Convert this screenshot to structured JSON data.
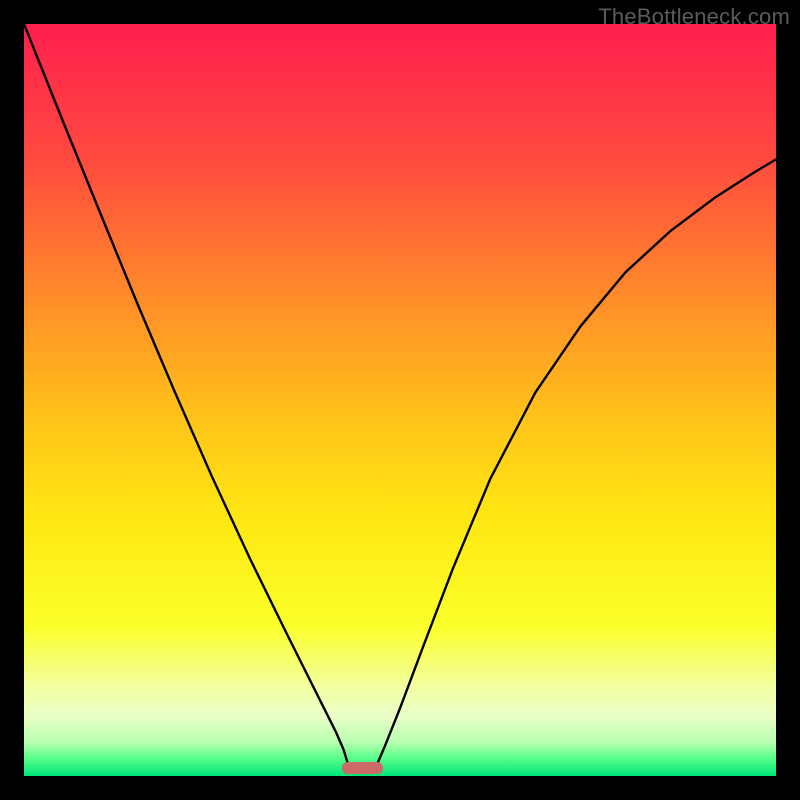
{
  "watermark": "TheBottleneck.com",
  "chart_data": {
    "type": "line",
    "title": "",
    "xlabel": "",
    "ylabel": "",
    "xlim": [
      0,
      1
    ],
    "ylim": [
      0,
      1
    ],
    "grid": false,
    "legend": false,
    "background_gradient_stops": [
      {
        "offset": 0.0,
        "color": "#ff1f4e"
      },
      {
        "offset": 0.18,
        "color": "#ff4a3f"
      },
      {
        "offset": 0.36,
        "color": "#ff8a2a"
      },
      {
        "offset": 0.52,
        "color": "#ffc21a"
      },
      {
        "offset": 0.66,
        "color": "#ffe812"
      },
      {
        "offset": 0.8,
        "color": "#fbff2a"
      },
      {
        "offset": 0.88,
        "color": "#f3ffa0"
      },
      {
        "offset": 0.92,
        "color": "#eaffc8"
      },
      {
        "offset": 0.955,
        "color": "#b8ffb0"
      },
      {
        "offset": 0.975,
        "color": "#5dff8a"
      },
      {
        "offset": 1.0,
        "color": "#00e67a"
      }
    ],
    "series": [
      {
        "name": "left-curve",
        "color": "#000000",
        "x": [
          0.0,
          0.05,
          0.1,
          0.15,
          0.2,
          0.25,
          0.3,
          0.35,
          0.38,
          0.4,
          0.415,
          0.425,
          0.432
        ],
        "y": [
          1.0,
          0.875,
          0.752,
          0.63,
          0.512,
          0.398,
          0.29,
          0.188,
          0.128,
          0.088,
          0.058,
          0.035,
          0.012
        ]
      },
      {
        "name": "right-curve",
        "color": "#000000",
        "x": [
          0.468,
          0.48,
          0.5,
          0.53,
          0.57,
          0.62,
          0.68,
          0.74,
          0.8,
          0.86,
          0.92,
          0.97,
          1.0
        ],
        "y": [
          0.012,
          0.04,
          0.09,
          0.17,
          0.275,
          0.395,
          0.51,
          0.598,
          0.67,
          0.725,
          0.77,
          0.802,
          0.82
        ]
      }
    ],
    "marker": {
      "name": "bottom-marker",
      "color": "#cc6a68",
      "x_center": 0.45,
      "width": 0.055,
      "height": 0.016
    }
  }
}
